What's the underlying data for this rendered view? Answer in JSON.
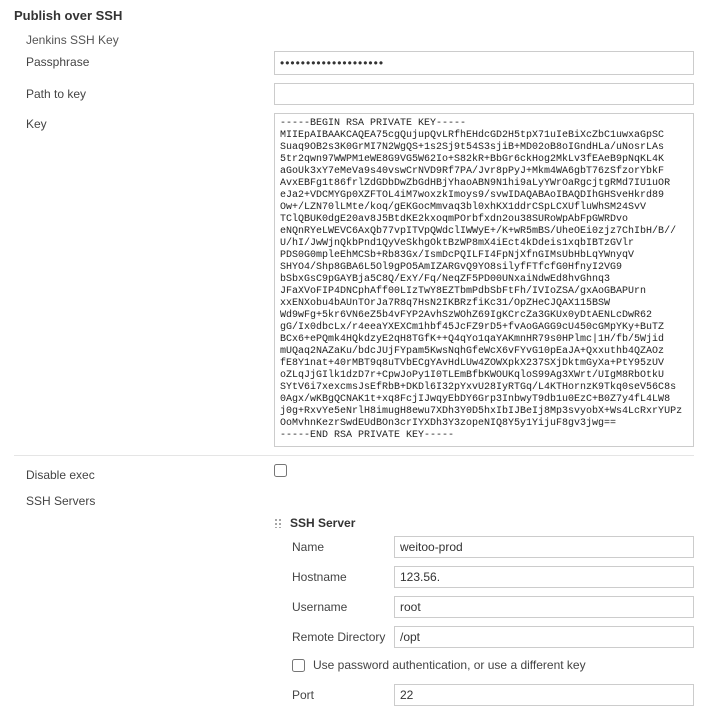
{
  "section": {
    "title": "Publish over SSH",
    "jenkins_key_label": "Jenkins SSH Key"
  },
  "fields": {
    "passphrase_label": "Passphrase",
    "passphrase_value": "••••••••••••••••••••",
    "path_to_key_label": "Path to key",
    "path_to_key_value": "",
    "key_label": "Key",
    "key_value": "-----BEGIN RSA PRIVATE KEY-----\nMIIEpAIBAAKCAQEA75cgQujupQvLRfhEHdcGD2H5tpX71uIeBiXcZbC1uwxaGpSC\nSuaq9OB2s3K0GrMI7N2WgQS+1s2Sj9t54S3sjiB+MD02oB8oIGndHLa/uNosrLAs\n5tr2qwn97WWPM1eWE8G9VG5W62Io+S82kR+BbGr6ckHog2MkLv3fEAeB9pNqKL4K\naGoUk3xY7eMeVa9s40vswCrNVD9Rf7PA/Jvr8pPyJ+Mkm4WA6gbT76zSfzorYbkF\nAvxEBFg1t86frlZdGDbDwZbGdHBjYhaoABN9N1hi9aLyYWrOaRgcjtgRMd7IU1uOR\neJa2+VDCMYGp0XZFTOL4iM7woxzkImoys9/svwIDAQABAoIBAQDIhGHSveHkrd89\nOw+/LZN70lLMte/koq/gEKGocMmvaq3bl0xhKX1ddrCSpLCXUfluWhSM24SvV\nTClQBUK0dgE20av8J5BtdKE2kxoqmPOrbfxdn2ou38SURoWpAbFpGWRDvo\neNQnRYeLWEVC6AxQb77vpITVpQWdclIWWyE+/K+wR5mBS/UheOEi0zjz7ChIbH/B//\nU/hI/JwWjnQkbPnd1QyVeSkhgOktBzWP8mX4iEct4kDdeis1xqbIBTzGVlr\nPDS0G0mpleEhMCSb+Rb83Gx/IsmDcPQILFI4FpNjXfnGIMsUbHbLqYWnyqV\nSHYO4/Shp8GBA6L5Ol9gPO5AmIZARGvQ9YO8silyfFTfcfG0HfnyI2VG9\nbSbxGsC9pGAYBja5C8Q/ExY/Fq/NeqZF5PD00UNxaiNdwEd8hvGhnq3\nJFaXVoFIP4DNCphAff00LIzTwY8EZTbmPdbSbFtFh/IVIoZSA/gxAoGBAPUrn\nxxENXobu4bAUnTOrJa7R8q7HsN2IKBRzfiKc31/OpZHeCJQAX115BSW\nWd9wFg+5kr6VN6eZ5b4vFYP2AvhSzWOhZ69IgKCrcZa3GKUx0yDtAENLcDwR62\ngG/Ix0dbcLx/r4eeaYXEXCm1hbf45JcFZ9rD5+fvAoGAGG9cU450cGMpYKy+BuTZ\nBCx6+ePQmk4HQkdzyE2qH8TGfK++Q4qYo1qaYAKmnHR79s0HPlmc|1H/fb/5Wjid\nmUQaq2NAZaKu/bdcJUjFYpam5KwsNqhGfeWcX6vFYvG10pEaJA+Qxxuthb4QZAOz\nfE8Y1nat+40rMBT9q8uTVbECgYAvHdLUw4ZOWXpkX237SXjDktmGyXa+PtY95zUV\noZLqJjGIlk1dzD7r+CpwJoPy1I0TLEmBfbKWOUKqloS99Ag3XWrt/UIgM8RbOtkU\nSYtV6i7xexcmsJsEfRbB+DKDl6I32pYxvU28IyRTGq/L4KTHornzK9Tkq0seV56C8s\n0Agx/wKBgQCNAK1t+xq8FcjIJwqyEbDY6Grp3InbwyT9db1u0EzC+B0Z7y4fL4LW8\nj0g+RxvYe5eNrlH8imugH8ewu7XDh3Y0D5hxIbIJBeIj8Mp3svyobX+Ws4LcRxrYUPz\nOoMvhnKezrSwdEUdBOn3crIYXDh3Y3zopeNIQ8Y5y1YijuF8gv3jwg==\n-----END RSA PRIVATE KEY-----",
    "disable_exec_label": "Disable exec",
    "disable_exec_checked": false,
    "ssh_servers_label": "SSH Servers"
  },
  "ssh_server": {
    "block_title": "SSH Server",
    "name_label": "Name",
    "name_value": "weitoo-prod",
    "hostname_label": "Hostname",
    "hostname_value": "123.56.",
    "username_label": "Username",
    "username_value": "root",
    "remote_dir_label": "Remote Directory",
    "remote_dir_value": "/opt",
    "use_password_label": "Use password authentication, or use a different key",
    "use_password_checked": false,
    "port_label": "Port",
    "port_value": "22"
  }
}
